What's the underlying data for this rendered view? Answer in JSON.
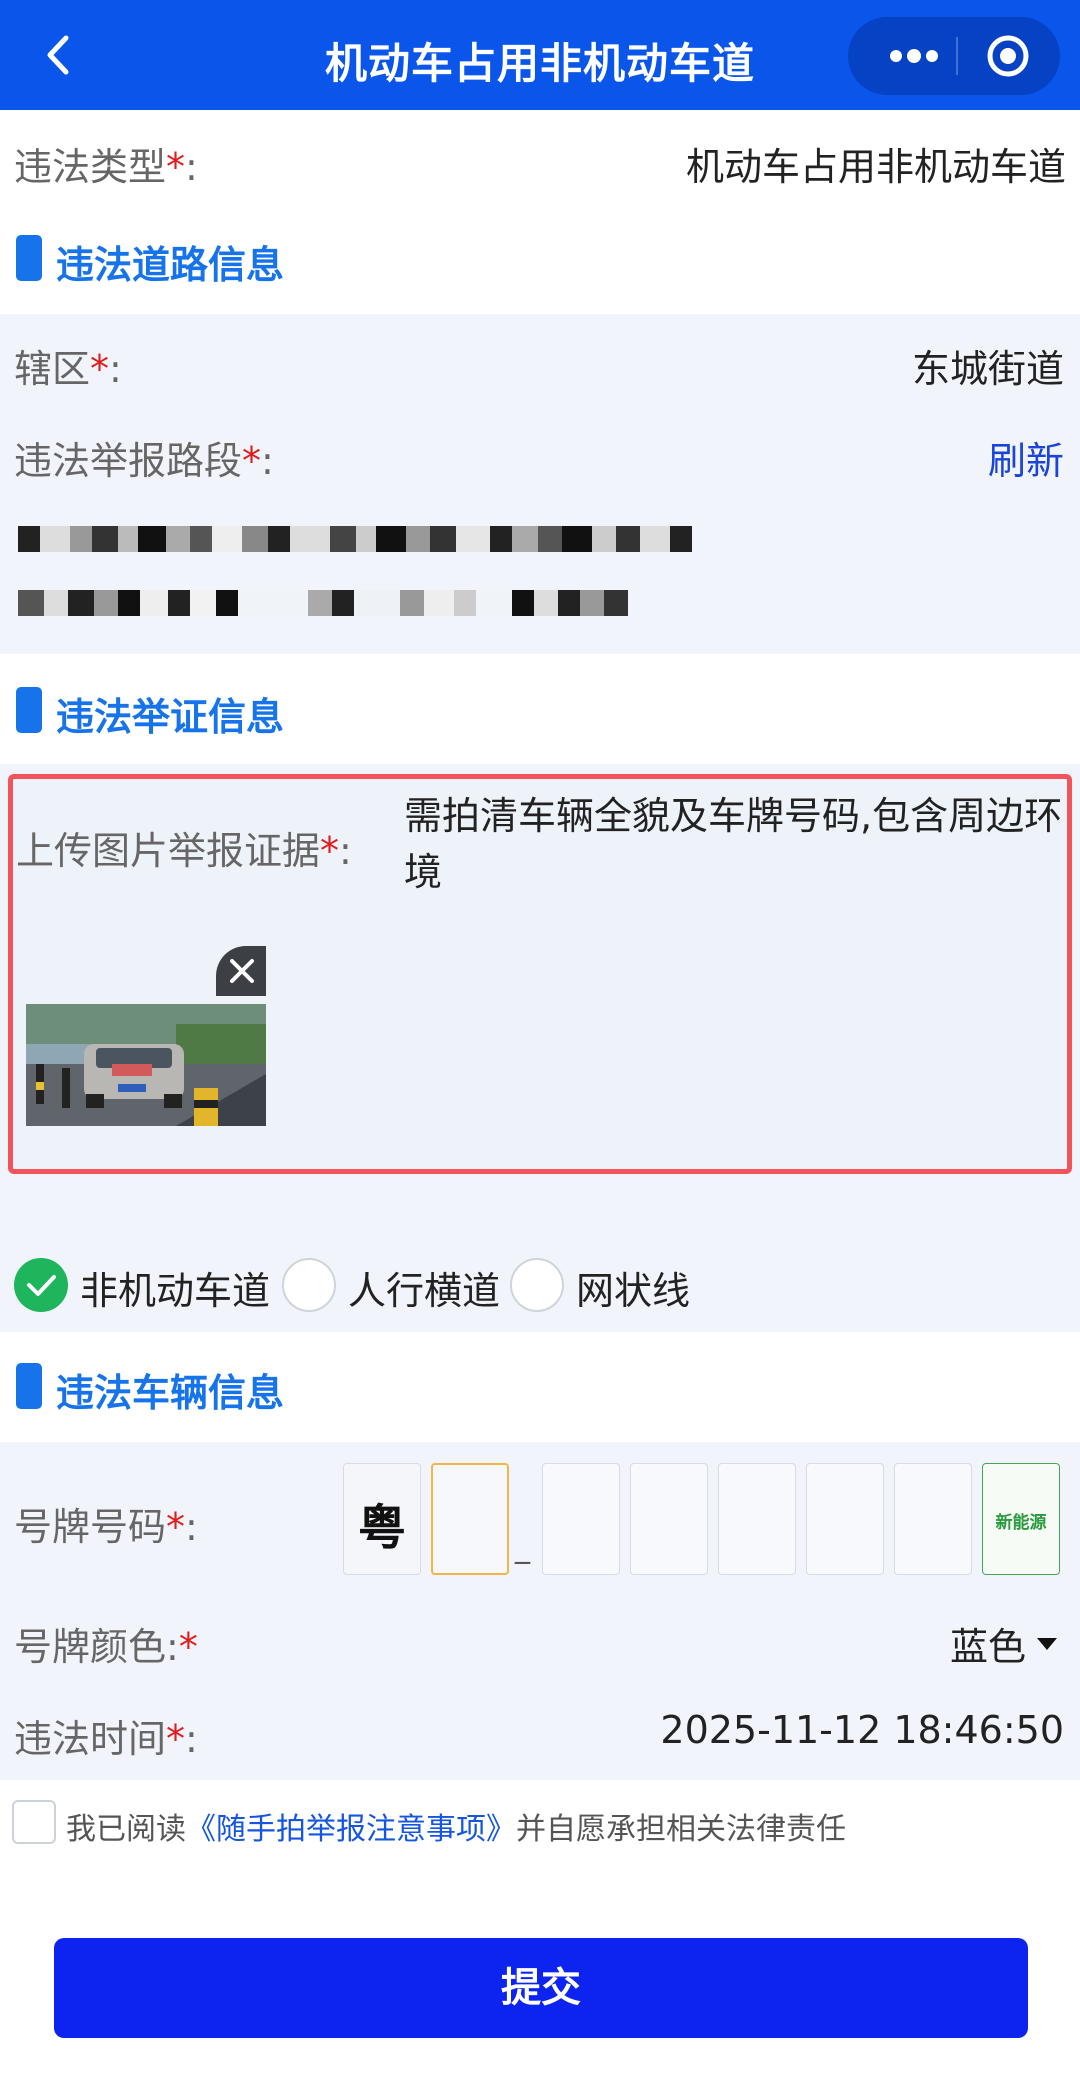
{
  "header": {
    "title": "机动车占用非机动车道",
    "back_icon": "chevron-left-icon",
    "more_icon": "more-dots-icon",
    "target_icon": "target-icon"
  },
  "violation_type": {
    "label": "违法类型",
    "value": "机动车占用非机动车道"
  },
  "sections": {
    "road": "违法道路信息",
    "evidence": "违法举证信息",
    "vehicle": "违法车辆信息"
  },
  "road": {
    "district_label": "辖区",
    "district_value": "东城街道",
    "segment_label": "违法举报路段",
    "refresh": "刷新"
  },
  "evidence": {
    "upload_label": "上传图片举报证据",
    "hint": "需拍清车辆全貌及车牌号码,包含周边环境",
    "remove_icon": "close-icon"
  },
  "location_options": {
    "items": [
      {
        "label": "非机动车道",
        "checked": true
      },
      {
        "label": "人行横道",
        "checked": false
      },
      {
        "label": "网状线",
        "checked": false
      }
    ]
  },
  "vehicle": {
    "plate_label": "号牌号码",
    "province": "粤",
    "new_energy": "新能源",
    "separator": "_",
    "color_label": "号牌颜色:",
    "color_value": "蓝色",
    "time_label": "违法时间",
    "time_value": "2025-11-12 18:46:50"
  },
  "agreement": {
    "prefix": "我已阅读",
    "link": "《随手拍举报注意事项》",
    "suffix": "并自愿承担相关法律责任"
  },
  "submit": "提交",
  "colors": {
    "header": "#0a55ea",
    "accent": "#1673ea",
    "submit": "#0d24f0",
    "highlight_border": "#f2545b",
    "checked": "#1fb55c"
  }
}
